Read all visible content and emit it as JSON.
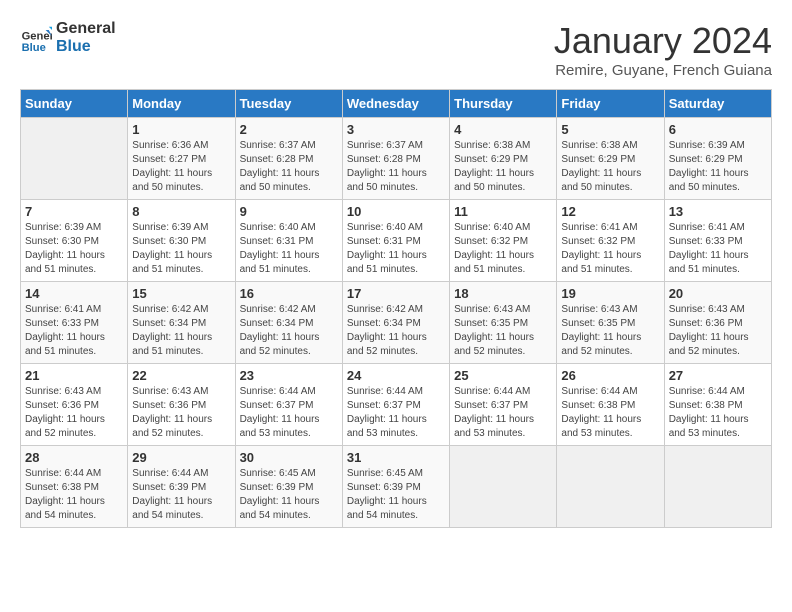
{
  "header": {
    "logo_line1": "General",
    "logo_line2": "Blue",
    "month": "January 2024",
    "location": "Remire, Guyane, French Guiana"
  },
  "weekdays": [
    "Sunday",
    "Monday",
    "Tuesday",
    "Wednesday",
    "Thursday",
    "Friday",
    "Saturday"
  ],
  "weeks": [
    [
      {
        "day": "",
        "info": ""
      },
      {
        "day": "1",
        "info": "Sunrise: 6:36 AM\nSunset: 6:27 PM\nDaylight: 11 hours\nand 50 minutes."
      },
      {
        "day": "2",
        "info": "Sunrise: 6:37 AM\nSunset: 6:28 PM\nDaylight: 11 hours\nand 50 minutes."
      },
      {
        "day": "3",
        "info": "Sunrise: 6:37 AM\nSunset: 6:28 PM\nDaylight: 11 hours\nand 50 minutes."
      },
      {
        "day": "4",
        "info": "Sunrise: 6:38 AM\nSunset: 6:29 PM\nDaylight: 11 hours\nand 50 minutes."
      },
      {
        "day": "5",
        "info": "Sunrise: 6:38 AM\nSunset: 6:29 PM\nDaylight: 11 hours\nand 50 minutes."
      },
      {
        "day": "6",
        "info": "Sunrise: 6:39 AM\nSunset: 6:29 PM\nDaylight: 11 hours\nand 50 minutes."
      }
    ],
    [
      {
        "day": "7",
        "info": "Sunrise: 6:39 AM\nSunset: 6:30 PM\nDaylight: 11 hours\nand 51 minutes."
      },
      {
        "day": "8",
        "info": "Sunrise: 6:39 AM\nSunset: 6:30 PM\nDaylight: 11 hours\nand 51 minutes."
      },
      {
        "day": "9",
        "info": "Sunrise: 6:40 AM\nSunset: 6:31 PM\nDaylight: 11 hours\nand 51 minutes."
      },
      {
        "day": "10",
        "info": "Sunrise: 6:40 AM\nSunset: 6:31 PM\nDaylight: 11 hours\nand 51 minutes."
      },
      {
        "day": "11",
        "info": "Sunrise: 6:40 AM\nSunset: 6:32 PM\nDaylight: 11 hours\nand 51 minutes."
      },
      {
        "day": "12",
        "info": "Sunrise: 6:41 AM\nSunset: 6:32 PM\nDaylight: 11 hours\nand 51 minutes."
      },
      {
        "day": "13",
        "info": "Sunrise: 6:41 AM\nSunset: 6:33 PM\nDaylight: 11 hours\nand 51 minutes."
      }
    ],
    [
      {
        "day": "14",
        "info": "Sunrise: 6:41 AM\nSunset: 6:33 PM\nDaylight: 11 hours\nand 51 minutes."
      },
      {
        "day": "15",
        "info": "Sunrise: 6:42 AM\nSunset: 6:34 PM\nDaylight: 11 hours\nand 51 minutes."
      },
      {
        "day": "16",
        "info": "Sunrise: 6:42 AM\nSunset: 6:34 PM\nDaylight: 11 hours\nand 52 minutes."
      },
      {
        "day": "17",
        "info": "Sunrise: 6:42 AM\nSunset: 6:34 PM\nDaylight: 11 hours\nand 52 minutes."
      },
      {
        "day": "18",
        "info": "Sunrise: 6:43 AM\nSunset: 6:35 PM\nDaylight: 11 hours\nand 52 minutes."
      },
      {
        "day": "19",
        "info": "Sunrise: 6:43 AM\nSunset: 6:35 PM\nDaylight: 11 hours\nand 52 minutes."
      },
      {
        "day": "20",
        "info": "Sunrise: 6:43 AM\nSunset: 6:36 PM\nDaylight: 11 hours\nand 52 minutes."
      }
    ],
    [
      {
        "day": "21",
        "info": "Sunrise: 6:43 AM\nSunset: 6:36 PM\nDaylight: 11 hours\nand 52 minutes."
      },
      {
        "day": "22",
        "info": "Sunrise: 6:43 AM\nSunset: 6:36 PM\nDaylight: 11 hours\nand 52 minutes."
      },
      {
        "day": "23",
        "info": "Sunrise: 6:44 AM\nSunset: 6:37 PM\nDaylight: 11 hours\nand 53 minutes."
      },
      {
        "day": "24",
        "info": "Sunrise: 6:44 AM\nSunset: 6:37 PM\nDaylight: 11 hours\nand 53 minutes."
      },
      {
        "day": "25",
        "info": "Sunrise: 6:44 AM\nSunset: 6:37 PM\nDaylight: 11 hours\nand 53 minutes."
      },
      {
        "day": "26",
        "info": "Sunrise: 6:44 AM\nSunset: 6:38 PM\nDaylight: 11 hours\nand 53 minutes."
      },
      {
        "day": "27",
        "info": "Sunrise: 6:44 AM\nSunset: 6:38 PM\nDaylight: 11 hours\nand 53 minutes."
      }
    ],
    [
      {
        "day": "28",
        "info": "Sunrise: 6:44 AM\nSunset: 6:38 PM\nDaylight: 11 hours\nand 54 minutes."
      },
      {
        "day": "29",
        "info": "Sunrise: 6:44 AM\nSunset: 6:39 PM\nDaylight: 11 hours\nand 54 minutes."
      },
      {
        "day": "30",
        "info": "Sunrise: 6:45 AM\nSunset: 6:39 PM\nDaylight: 11 hours\nand 54 minutes."
      },
      {
        "day": "31",
        "info": "Sunrise: 6:45 AM\nSunset: 6:39 PM\nDaylight: 11 hours\nand 54 minutes."
      },
      {
        "day": "",
        "info": ""
      },
      {
        "day": "",
        "info": ""
      },
      {
        "day": "",
        "info": ""
      }
    ]
  ]
}
